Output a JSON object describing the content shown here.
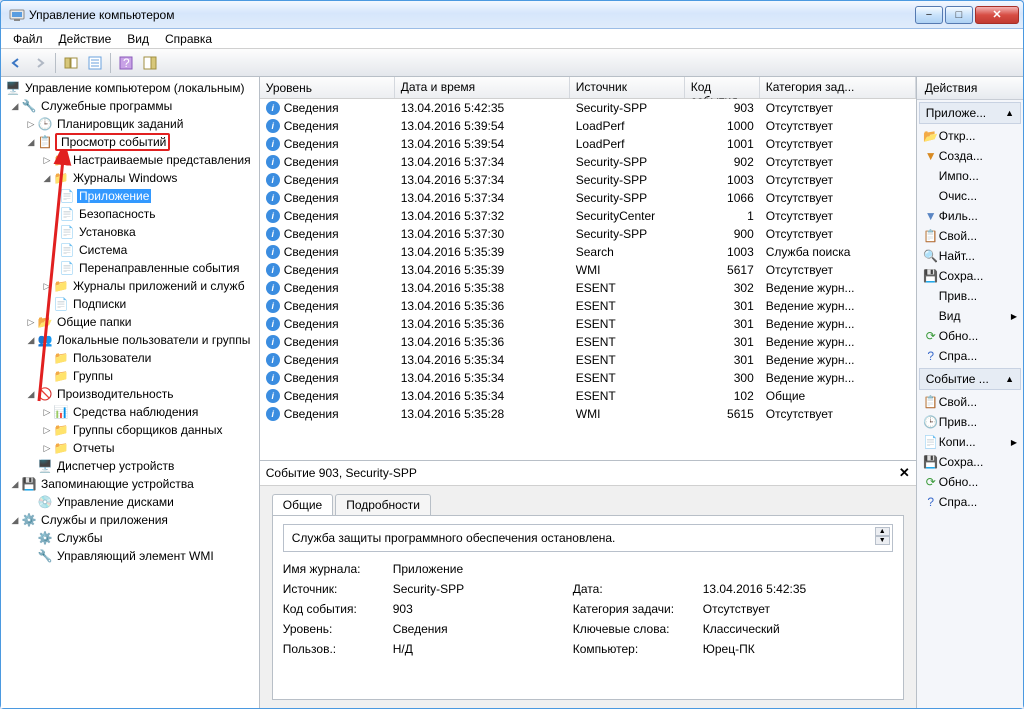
{
  "window": {
    "title": "Управление компьютером"
  },
  "menu": {
    "file": "Файл",
    "action": "Действие",
    "view": "Вид",
    "help": "Справка"
  },
  "tree": {
    "root": "Управление компьютером (локальным)",
    "system_tools": "Служебные программы",
    "task_scheduler": "Планировщик заданий",
    "event_viewer": "Просмотр событий",
    "custom_views": "Настраиваемые представления",
    "windows_logs": "Журналы Windows",
    "application": "Приложение",
    "security": "Безопасность",
    "setup": "Установка",
    "system": "Система",
    "forwarded": "Перенаправленные события",
    "app_services_logs": "Журналы приложений и служб",
    "subscriptions": "Подписки",
    "shared_folders": "Общие папки",
    "local_users": "Локальные пользователи и группы",
    "users": "Пользователи",
    "groups": "Группы",
    "performance": "Производительность",
    "monitoring_tools": "Средства наблюдения",
    "data_collector": "Группы сборщиков данных",
    "reports": "Отчеты",
    "device_manager": "Диспетчер устройств",
    "storage": "Запоминающие устройства",
    "disk_mgmt": "Управление дисками",
    "services_apps": "Службы и приложения",
    "services": "Службы",
    "wmi": "Управляющий элемент WMI"
  },
  "columns": {
    "level": "Уровень",
    "datetime": "Дата и время",
    "source": "Источник",
    "eventid": "Код события",
    "category": "Категория зад..."
  },
  "level_label": "Сведения",
  "events": [
    {
      "dt": "13.04.2016 5:42:35",
      "src": "Security-SPP",
      "id": "903",
      "cat": "Отсутствует"
    },
    {
      "dt": "13.04.2016 5:39:54",
      "src": "LoadPerf",
      "id": "1000",
      "cat": "Отсутствует"
    },
    {
      "dt": "13.04.2016 5:39:54",
      "src": "LoadPerf",
      "id": "1001",
      "cat": "Отсутствует"
    },
    {
      "dt": "13.04.2016 5:37:34",
      "src": "Security-SPP",
      "id": "902",
      "cat": "Отсутствует"
    },
    {
      "dt": "13.04.2016 5:37:34",
      "src": "Security-SPP",
      "id": "1003",
      "cat": "Отсутствует"
    },
    {
      "dt": "13.04.2016 5:37:34",
      "src": "Security-SPP",
      "id": "1066",
      "cat": "Отсутствует"
    },
    {
      "dt": "13.04.2016 5:37:32",
      "src": "SecurityCenter",
      "id": "1",
      "cat": "Отсутствует"
    },
    {
      "dt": "13.04.2016 5:37:30",
      "src": "Security-SPP",
      "id": "900",
      "cat": "Отсутствует"
    },
    {
      "dt": "13.04.2016 5:35:39",
      "src": "Search",
      "id": "1003",
      "cat": "Служба поиска"
    },
    {
      "dt": "13.04.2016 5:35:39",
      "src": "WMI",
      "id": "5617",
      "cat": "Отсутствует"
    },
    {
      "dt": "13.04.2016 5:35:38",
      "src": "ESENT",
      "id": "302",
      "cat": "Ведение журн..."
    },
    {
      "dt": "13.04.2016 5:35:36",
      "src": "ESENT",
      "id": "301",
      "cat": "Ведение журн..."
    },
    {
      "dt": "13.04.2016 5:35:36",
      "src": "ESENT",
      "id": "301",
      "cat": "Ведение журн..."
    },
    {
      "dt": "13.04.2016 5:35:36",
      "src": "ESENT",
      "id": "301",
      "cat": "Ведение журн..."
    },
    {
      "dt": "13.04.2016 5:35:34",
      "src": "ESENT",
      "id": "301",
      "cat": "Ведение журн..."
    },
    {
      "dt": "13.04.2016 5:35:34",
      "src": "ESENT",
      "id": "300",
      "cat": "Ведение журн..."
    },
    {
      "dt": "13.04.2016 5:35:34",
      "src": "ESENT",
      "id": "102",
      "cat": "Общие"
    },
    {
      "dt": "13.04.2016 5:35:28",
      "src": "WMI",
      "id": "5615",
      "cat": "Отсутствует"
    }
  ],
  "detail": {
    "title": "Событие 903, Security-SPP",
    "tabs": {
      "general": "Общие",
      "details": "Подробности"
    },
    "message": "Служба защиты программного обеспечения остановлена.",
    "fields": {
      "log_name_k": "Имя журнала:",
      "log_name_v": "Приложение",
      "source_k": "Источник:",
      "source_v": "Security-SPP",
      "date_k": "Дата:",
      "date_v": "13.04.2016 5:42:35",
      "eventid_k": "Код события:",
      "eventid_v": "903",
      "category_k": "Категория задачи:",
      "category_v": "Отсутствует",
      "level_k": "Уровень:",
      "level_v": "Сведения",
      "keywords_k": "Ключевые слова:",
      "keywords_v": "Классический",
      "user_k": "Пользов.:",
      "user_v": "Н/Д",
      "computer_k": "Компьютер:",
      "computer_v": "Юрец-ПК"
    }
  },
  "actions": {
    "header": "Действия",
    "section1": "Приложе...",
    "open": "Откр...",
    "create": "Созда...",
    "import": "Импо...",
    "clear": "Очис...",
    "filter": "Филь...",
    "properties": "Свой...",
    "find": "Найт...",
    "save": "Сохра...",
    "attach": "Прив...",
    "view": "Вид",
    "refresh": "Обно...",
    "help": "Спра...",
    "section2": "Событие ...",
    "eventprops": "Свой...",
    "attach2": "Прив...",
    "copy": "Копи...",
    "save2": "Сохра...",
    "refresh2": "Обно...",
    "help2": "Спра..."
  }
}
